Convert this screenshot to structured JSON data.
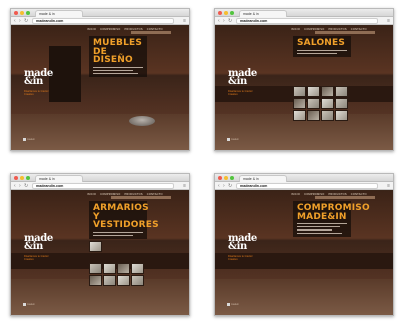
{
  "site": {
    "tab_title": "made & in",
    "url": "madeandin.com",
    "nav_items": [
      "INICIO",
      "COMPROMISO",
      "PRODUCTOS",
      "CONTACTO"
    ],
    "logo_line1": "made",
    "logo_line2": "&in",
    "tagline": "Diseñamos tu Interior Creativo",
    "credit": "madein"
  },
  "windows": [
    {
      "section_title_1": "MUEBLES DE",
      "section_title_2": "DISEÑO"
    },
    {
      "section_title_1": "SALONES",
      "section_title_2": ""
    },
    {
      "section_title_1": "ARMARIOS Y",
      "section_title_2": "VESTIDORES"
    },
    {
      "section_title_1": "COMPROMISO",
      "section_title_2": "MADE&IN"
    }
  ],
  "icons": {
    "back": "back-arrow-icon",
    "forward": "forward-arrow-icon",
    "reload": "reload-icon",
    "menu": "menu-icon"
  }
}
